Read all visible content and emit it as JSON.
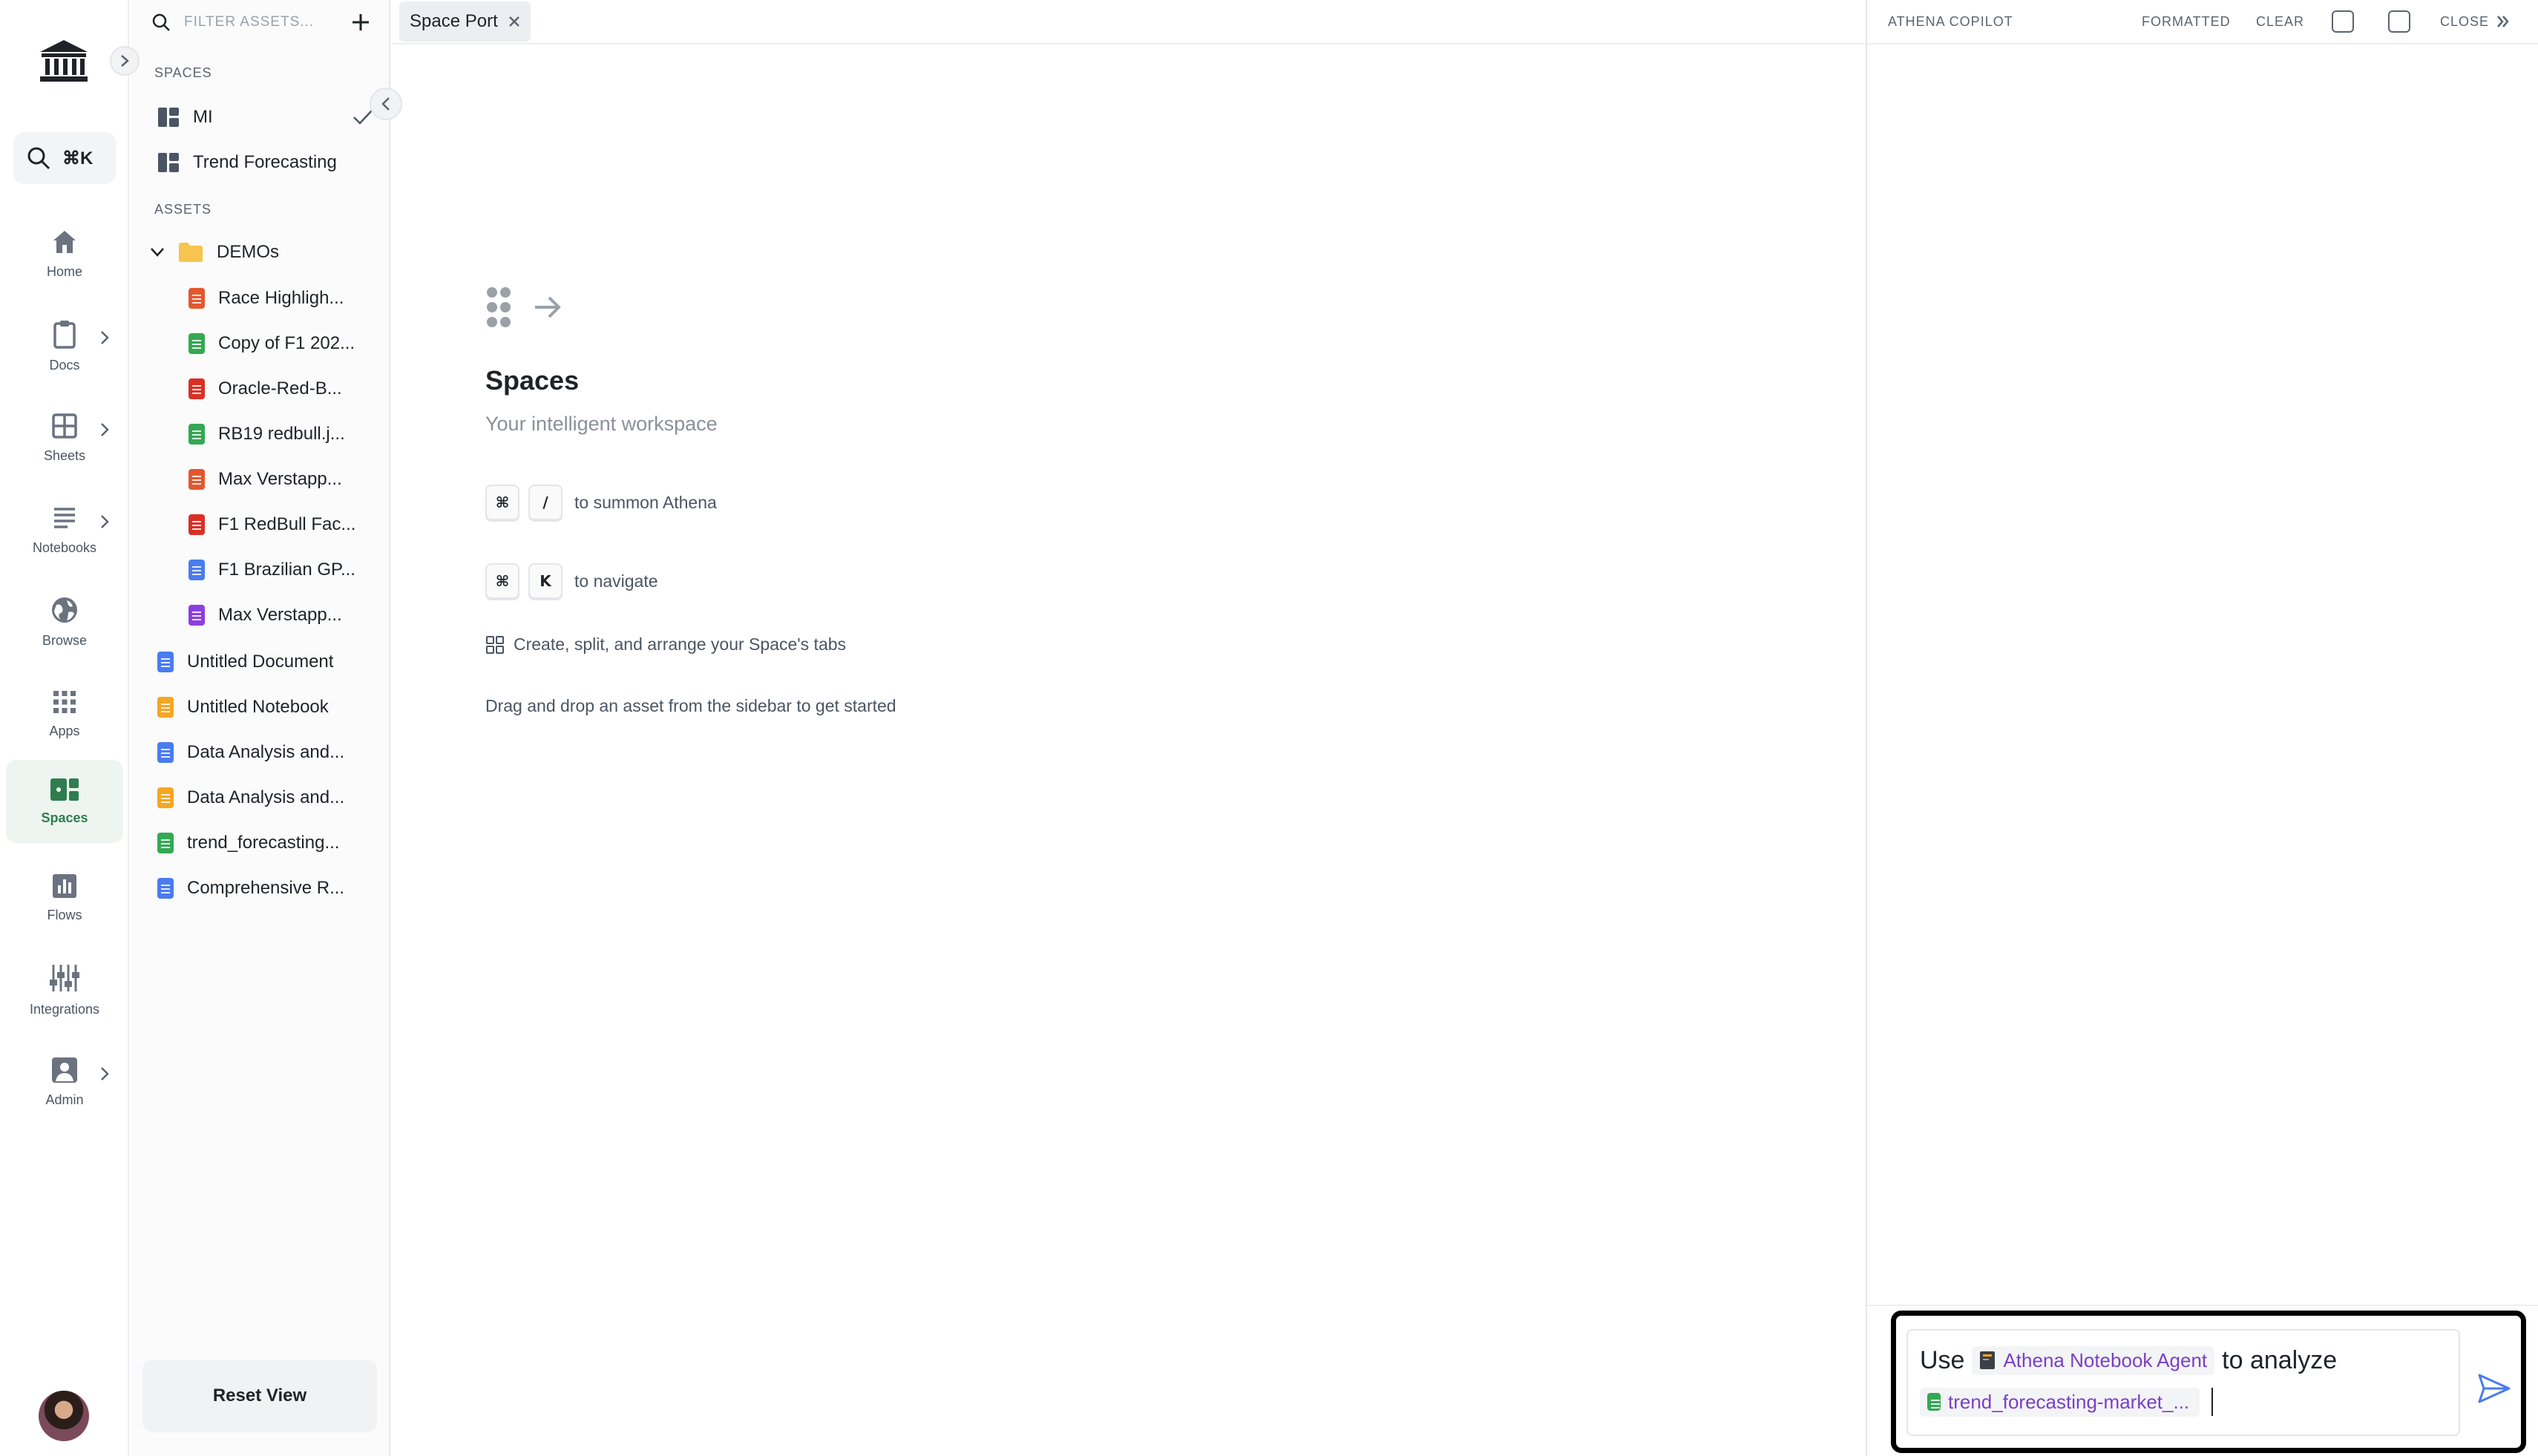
{
  "rail": {
    "search_shortcut": "⌘K",
    "items": [
      {
        "label": "Home",
        "icon": "home-icon"
      },
      {
        "label": "Docs",
        "icon": "clipboard-icon"
      },
      {
        "label": "Sheets",
        "icon": "grid-icon"
      },
      {
        "label": "Notebooks",
        "icon": "lines-icon"
      },
      {
        "label": "Browse",
        "icon": "globe-icon"
      },
      {
        "label": "Apps",
        "icon": "apps-icon"
      },
      {
        "label": "Spaces",
        "icon": "spaces-icon"
      },
      {
        "label": "Flows",
        "icon": "chart-icon"
      },
      {
        "label": "Integrations",
        "icon": "sliders-icon"
      },
      {
        "label": "Admin",
        "icon": "user-icon"
      }
    ],
    "active": "Spaces"
  },
  "assets": {
    "filter_placeholder": "FILTER ASSETS...",
    "spaces_heading": "SPACES",
    "spaces": [
      {
        "label": "MI",
        "selected": true
      },
      {
        "label": "Trend Forecasting",
        "selected": false
      }
    ],
    "assets_heading": "ASSETS",
    "folder": {
      "label": "DEMOs",
      "children": [
        {
          "label": "Race Highligh...",
          "type": "video",
          "color": "#e4572e"
        },
        {
          "label": "Copy of F1 202...",
          "type": "sheet",
          "color": "#34a853"
        },
        {
          "label": "Oracle-Red-B...",
          "type": "pdf",
          "color": "#d93025"
        },
        {
          "label": "RB19 redbull.j...",
          "type": "image",
          "color": "#34a853"
        },
        {
          "label": "Max Verstapp...",
          "type": "video",
          "color": "#e4572e"
        },
        {
          "label": "F1 RedBull Fac...",
          "type": "pdf",
          "color": "#d93025"
        },
        {
          "label": "F1 Brazilian GP...",
          "type": "doc",
          "color": "#4a7cf0"
        },
        {
          "label": "Max Verstapp...",
          "type": "audio",
          "color": "#8b3fe0"
        }
      ]
    },
    "files": [
      {
        "label": "Untitled Document",
        "type": "doc",
        "color": "#4a7cf0"
      },
      {
        "label": "Untitled Notebook",
        "type": "notebook",
        "color": "#f5a623"
      },
      {
        "label": "Data Analysis and...",
        "type": "doc",
        "color": "#4a7cf0"
      },
      {
        "label": "Data Analysis and...",
        "type": "notebook",
        "color": "#f5a623"
      },
      {
        "label": "trend_forecasting...",
        "type": "sheet",
        "color": "#34a853"
      },
      {
        "label": "Comprehensive R...",
        "type": "doc",
        "color": "#4a7cf0"
      }
    ],
    "reset_label": "Reset View"
  },
  "main": {
    "tab_label": "Space Port",
    "title": "Spaces",
    "subtitle": "Your intelligent workspace",
    "hints": {
      "summon_keys": [
        "⌘",
        "/"
      ],
      "summon_text": "to summon Athena",
      "navigate_keys": [
        "⌘",
        "K"
      ],
      "navigate_text": "to navigate",
      "arrange_text": "Create, split, and arrange your Space's tabs",
      "drag_text": "Drag and drop an asset from the sidebar to get started"
    }
  },
  "copilot": {
    "title": "ATHENA COPILOT",
    "formatted_label": "FORMATTED",
    "clear_label": "CLEAR",
    "close_label": "CLOSE",
    "message": {
      "prefix": "Use",
      "agent_chip": "Athena Notebook Agent",
      "middle": "to analyze",
      "file_chip": "trend_forecasting-market_..."
    }
  },
  "colors": {
    "accent_green": "#2e7d4f",
    "chip_purple": "#7b3fc4",
    "send_blue": "#4a7cf0"
  }
}
